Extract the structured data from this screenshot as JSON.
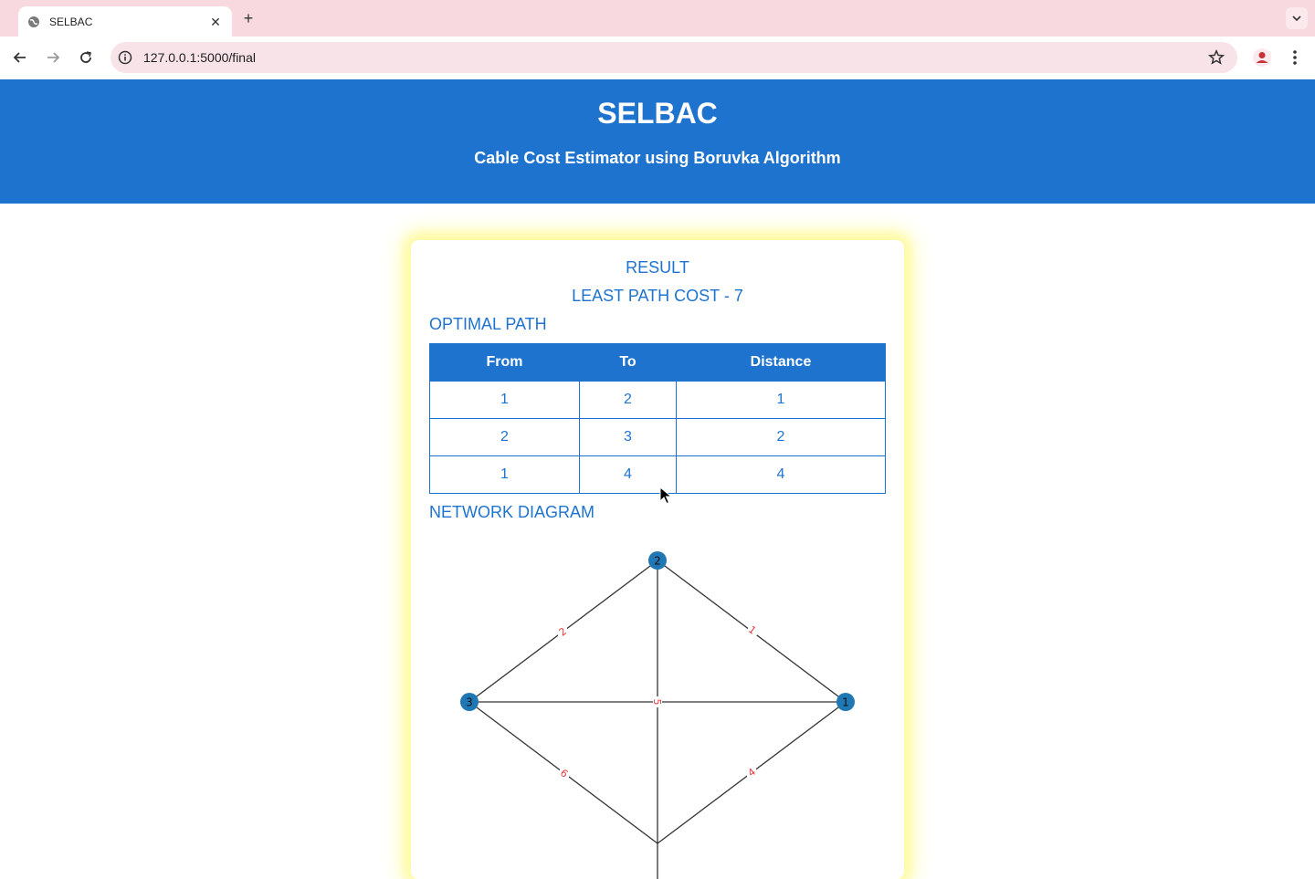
{
  "browser": {
    "tab_title": "SELBAC",
    "url": "127.0.0.1:5000/final"
  },
  "header": {
    "title": "SELBAC",
    "subtitle": "Cable Cost Estimator using Boruvka Algorithm"
  },
  "result": {
    "title": "RESULT",
    "cost_label": "LEAST PATH COST - 7",
    "optimal_heading": "OPTIMAL PATH",
    "table": {
      "headers": [
        "From",
        "To",
        "Distance"
      ],
      "rows": [
        [
          "1",
          "2",
          "1"
        ],
        [
          "2",
          "3",
          "2"
        ],
        [
          "1",
          "4",
          "4"
        ]
      ]
    },
    "diagram_heading": "NETWORK DIAGRAM"
  },
  "diagram": {
    "nodes": [
      "2",
      "3",
      "1"
    ],
    "edge_labels": [
      "2",
      "1",
      "5",
      "6",
      "4"
    ],
    "node_color": "#1f77b4",
    "label_color": "#e5383b"
  },
  "colors": {
    "accent": "#1e73cf",
    "tabstrip": "#f9d9e0",
    "glow": "#fdfb9a"
  }
}
